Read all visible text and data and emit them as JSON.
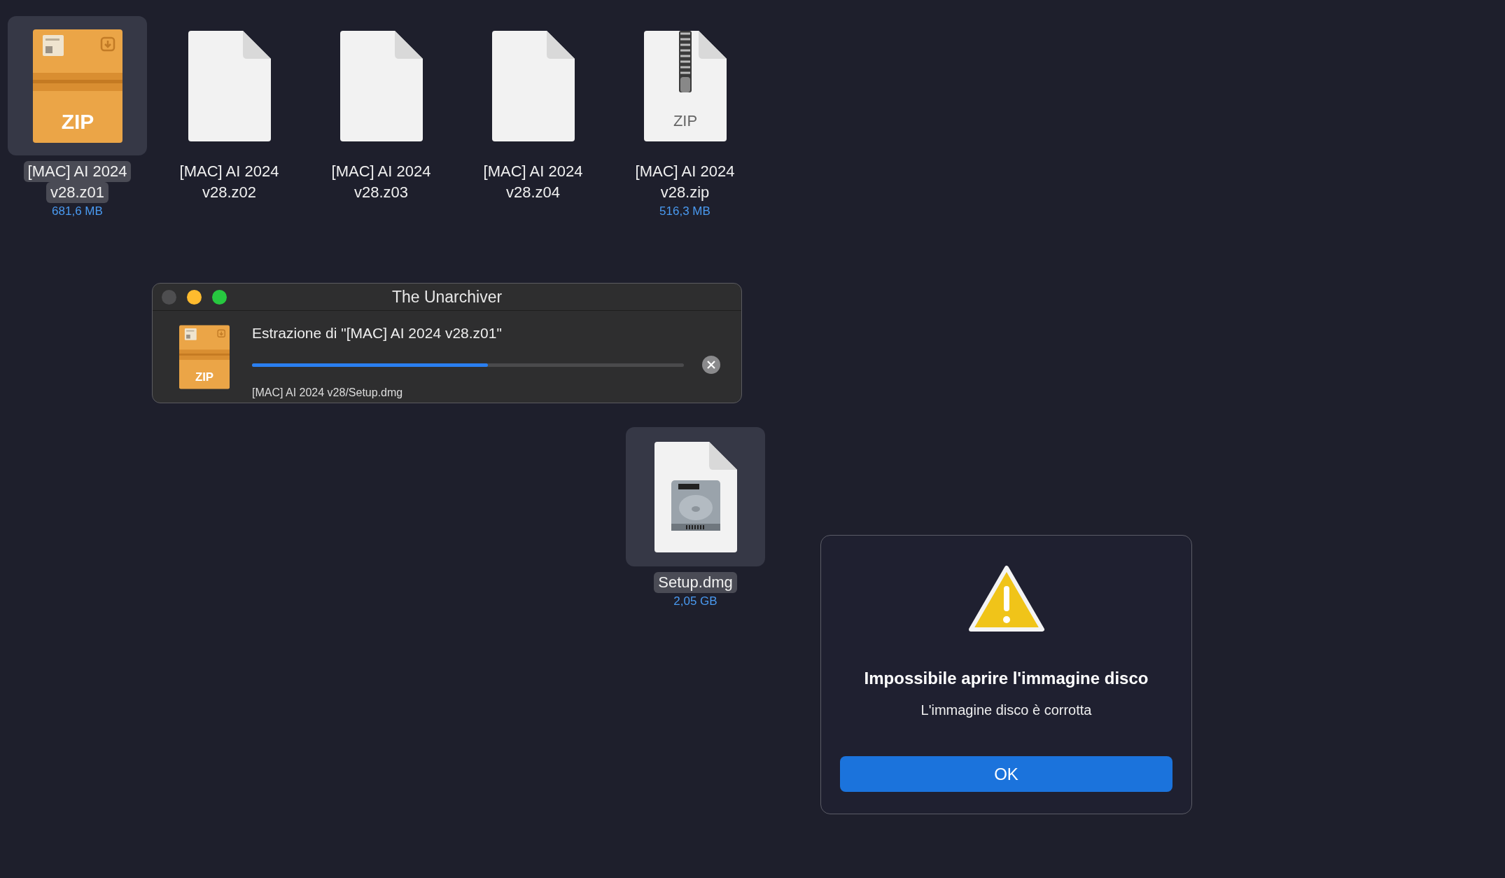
{
  "desktop_icons": [
    {
      "kind": "archive",
      "badge": "ZIP",
      "name_lines": [
        "[MAC] AI 2024",
        "v28.z01"
      ],
      "size": "681,6 MB",
      "selected": true
    },
    {
      "kind": "blank",
      "name_lines": [
        "[MAC] AI 2024",
        "v28.z02"
      ],
      "selected": false
    },
    {
      "kind": "blank",
      "name_lines": [
        "[MAC] AI 2024",
        "v28.z03"
      ],
      "selected": false
    },
    {
      "kind": "blank",
      "name_lines": [
        "[MAC] AI 2024",
        "v28.z04"
      ],
      "selected": false
    },
    {
      "kind": "zip",
      "badge": "ZIP",
      "name_lines": [
        "[MAC] AI 2024",
        "v28.zip"
      ],
      "size": "516,3 MB",
      "selected": false
    }
  ],
  "unarchiver": {
    "title": "The Unarchiver",
    "icon_badge": "ZIP",
    "heading": "Estrazione di \"[MAC] AI 2024 v28.z01\"",
    "level": 0.547,
    "current_file": "[MAC] AI 2024 v28/Setup.dmg"
  },
  "extracted_file": {
    "kind": "disk-image",
    "name_lines": [
      "Setup.dmg"
    ],
    "size": "2,05 GB",
    "selected": true
  },
  "alert": {
    "title": "Impossibile aprire l'immagine disco",
    "message": "L'immagine disco è corrotta",
    "button": "OK"
  }
}
